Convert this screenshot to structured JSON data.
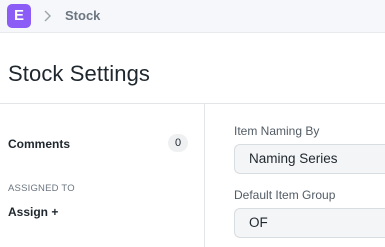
{
  "navbar": {
    "logo_letter": "E",
    "breadcrumb": "Stock"
  },
  "page": {
    "title": "Stock Settings"
  },
  "sidebar": {
    "comments_label": "Comments",
    "comments_count": "0",
    "assigned_to_label": "ASSIGNED TO",
    "assign_label": "Assign +"
  },
  "form": {
    "item_naming_by": {
      "label": "Item Naming By",
      "value": "Naming Series"
    },
    "default_item_group": {
      "label": "Default Item Group",
      "value": "OF"
    }
  },
  "colors": {
    "logo_bg": "#8b5cf6",
    "navbar_bg": "#f5f7fa",
    "input_bg": "#f4f5f6"
  }
}
